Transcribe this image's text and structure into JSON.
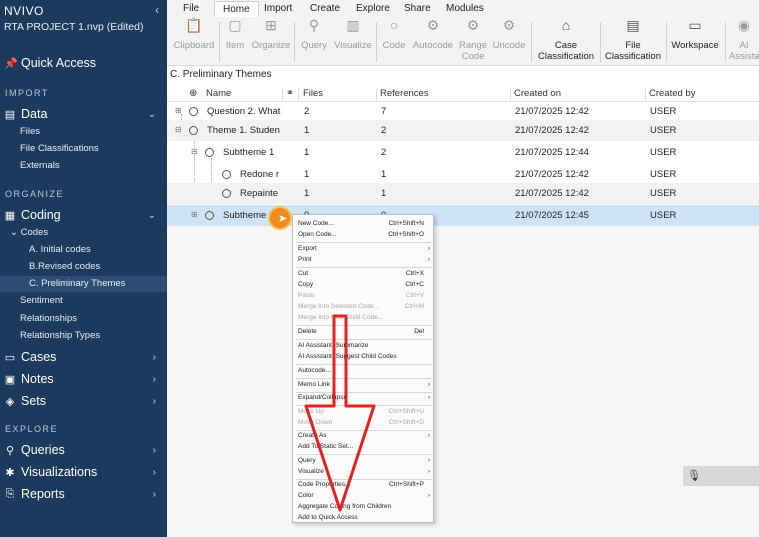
{
  "app": {
    "brand": "NVIVO",
    "project": "RTA PROJECT 1.nvp (Edited)"
  },
  "sidebar": {
    "quick_access": "Quick Access",
    "sections": {
      "import": "IMPORT",
      "organize": "ORGANIZE",
      "explore": "EXPLORE"
    },
    "data": {
      "label": "Data",
      "items": [
        "Files",
        "File Classifications",
        "Externals"
      ]
    },
    "coding": {
      "label": "Coding",
      "codes": "Codes",
      "code_items": [
        "A. Initial codes",
        "B.Revised codes",
        "C. Preliminary Themes"
      ],
      "items": [
        "Sentiment",
        "Relationships",
        "Relationship Types"
      ]
    },
    "cases": "Cases",
    "notes": "Notes",
    "sets": "Sets",
    "queries": "Queries",
    "visualizations": "Visualizations",
    "reports": "Reports"
  },
  "ribbon": {
    "tabs": [
      "File",
      "Home",
      "Import",
      "Create",
      "Explore",
      "Share",
      "Modules"
    ],
    "buttons": {
      "clipboard": "Clipboard",
      "item": "Item",
      "organize": "Organize",
      "query": "Query",
      "visualize": "Visualize",
      "code": "Code",
      "autocode": "Autocode",
      "range_code_1": "Range",
      "range_code_2": "Code",
      "uncode": "Uncode",
      "case_class_1": "Case",
      "case_class_2": "Classification",
      "file_class_1": "File",
      "file_class_2": "Classification",
      "workspace": "Workspace",
      "ai_1": "AI",
      "ai_2": "Assista"
    }
  },
  "list": {
    "title": "C. Preliminary Themes",
    "headers": {
      "name": "Name",
      "files": "Files",
      "references": "References",
      "created_on": "Created on",
      "created_by": "Created by"
    },
    "rows": [
      {
        "name": "Question 2. What",
        "files": "2",
        "refs": "7",
        "created": "21/07/2025 12:42",
        "by": "USER"
      },
      {
        "name": "Theme 1. Studen",
        "files": "1",
        "refs": "2",
        "created": "21/07/2025 12:42",
        "by": "USER"
      },
      {
        "name": "Subtheme 1",
        "files": "1",
        "refs": "2",
        "created": "21/07/2025 12:44",
        "by": "USER"
      },
      {
        "name": "Redone r",
        "files": "1",
        "refs": "1",
        "created": "21/07/2025 12:42",
        "by": "USER"
      },
      {
        "name": "Repainte",
        "files": "1",
        "refs": "1",
        "created": "21/07/2025 12:42",
        "by": "USER"
      },
      {
        "name": "Subtheme",
        "files": "0",
        "refs": "0",
        "created": "21/07/2025 12:45",
        "by": "USER"
      }
    ]
  },
  "context_menu": {
    "new_code": "New Code...",
    "new_code_sc": "Ctrl+Shift+N",
    "open_code": "Open Code...",
    "open_code_sc": "Ctrl+Shift+O",
    "export": "Export",
    "print": "Print",
    "cut": "Cut",
    "cut_sc": "Ctrl+X",
    "copy": "Copy",
    "copy_sc": "Ctrl+C",
    "paste": "Paste",
    "paste_sc": "Ctrl+V",
    "merge_selected": "Merge Into Selected Code...",
    "merge_selected_sc": "Ctrl+M",
    "merge_child": "Merge Into New Child Code...",
    "delete": "Delete",
    "delete_sc": "Del",
    "ai_summarize": "AI Assistant: Summarize",
    "ai_suggest": "AI Assistant: Suggest Child Codes",
    "autocode": "Autocode...",
    "memo_link": "Memo Link",
    "expand": "Expand/Collapse",
    "move_up": "Move Up",
    "move_up_sc": "Ctrl+Shift+U",
    "move_down": "Move Down",
    "move_down_sc": "Ctrl+Shift+D",
    "create_as": "Create As",
    "add_static": "Add To Static Set...",
    "query": "Query",
    "visualize": "Visualize",
    "code_props": "Code Properties...",
    "code_props_sc": "Ctrl+Shift+P",
    "color": "Color",
    "aggregate": "Aggregate Coding from Children",
    "add_quick": "Add to Quick Access"
  },
  "icons": {
    "search_tag": "microphone-icon"
  }
}
